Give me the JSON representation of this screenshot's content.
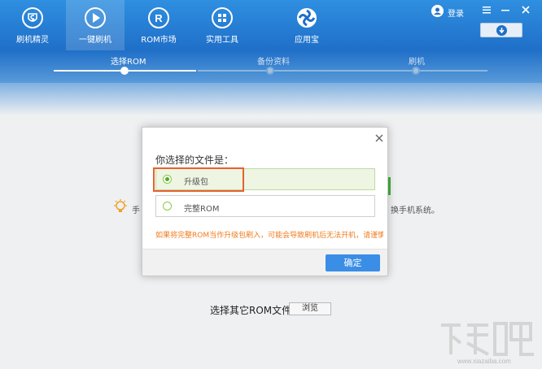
{
  "nav": {
    "items": [
      {
        "label": "刷机精灵",
        "icon": "shield-s-icon"
      },
      {
        "label": "一键刷机",
        "icon": "play-icon"
      },
      {
        "label": "ROM市场",
        "icon": "r-logo-icon"
      },
      {
        "label": "实用工具",
        "icon": "grid-icon"
      },
      {
        "label": "应用宝",
        "icon": "app-store-icon"
      }
    ],
    "active_index": 1
  },
  "window": {
    "login_label": "登录"
  },
  "steps": {
    "items": [
      {
        "label": "选择ROM"
      },
      {
        "label": "备份资料"
      },
      {
        "label": "刷机"
      }
    ],
    "current": 0
  },
  "background": {
    "tip_left": "手",
    "tip_right": "换手机系统。",
    "other_rom_label": "选择其它ROM文件",
    "browse_label": "浏览"
  },
  "dialog": {
    "title": "你选择的文件是：",
    "options": [
      {
        "label": "升级包",
        "selected": true
      },
      {
        "label": "完整ROM",
        "selected": false
      }
    ],
    "warning": "如果将完整ROM当作升级包刷入，可能会导致刷机后无法开机，请谨慎选择",
    "ok_label": "确定"
  },
  "watermark": {
    "url": "www.xiazaiba.com"
  },
  "colors": {
    "header_blue": "#1f6fc8",
    "accent_green": "#4caf1f",
    "warning_orange": "#f07b1d",
    "highlight_orange": "#e8602d",
    "button_blue": "#3a8ee6"
  }
}
